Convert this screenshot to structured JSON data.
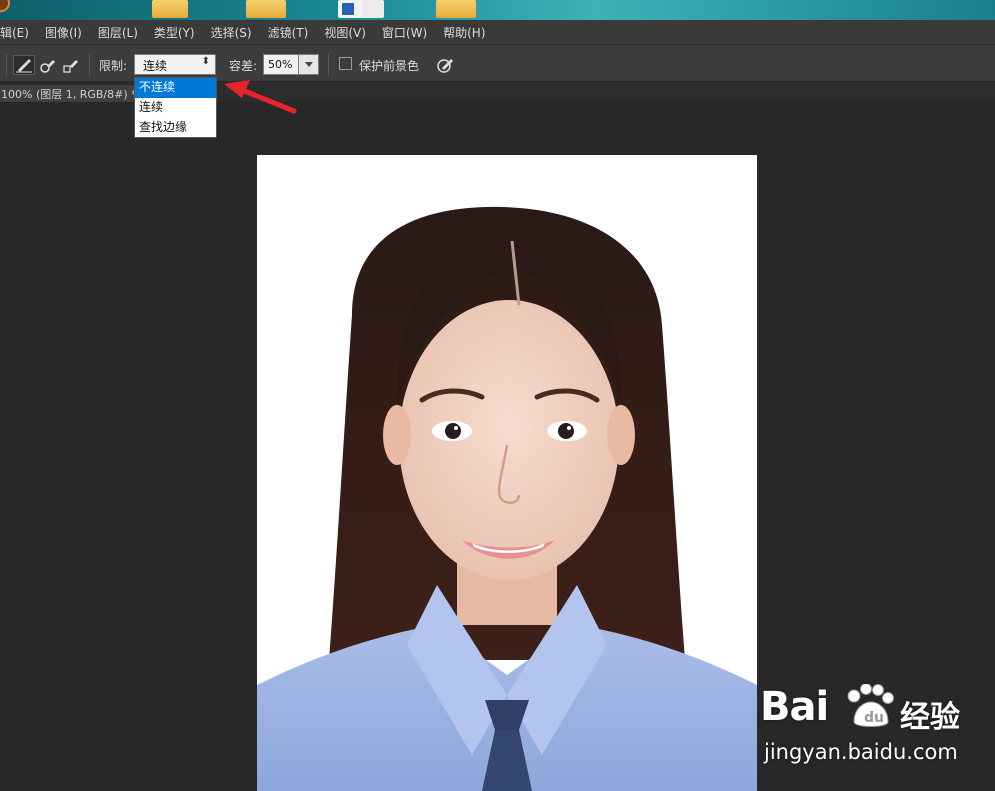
{
  "menubar": {
    "items": [
      {
        "label": "辑(E)"
      },
      {
        "label": "图像(I)"
      },
      {
        "label": "图层(L)"
      },
      {
        "label": "类型(Y)"
      },
      {
        "label": "选择(S)"
      },
      {
        "label": "滤镜(T)"
      },
      {
        "label": "视图(V)"
      },
      {
        "label": "窗口(W)"
      },
      {
        "label": "帮助(H)"
      }
    ]
  },
  "options": {
    "limit_label": "限制:",
    "limit_value": "连续",
    "limit_options": [
      "不连续",
      "连续",
      "查找边缘"
    ],
    "limit_highlighted": "不连续",
    "tolerance_label": "容差:",
    "tolerance_value": "50%",
    "protect_foreground_label": "保护前景色",
    "protect_foreground_checked": false
  },
  "document": {
    "tab_label": "100% (图层 1, RGB/8#) *"
  },
  "watermark": {
    "brand": "Bai",
    "brand_suffix": "经验",
    "url": "jingyan.baidu.com"
  },
  "colors": {
    "annotation_arrow": "#e8232b",
    "dropdown_highlight": "#0078d7"
  }
}
